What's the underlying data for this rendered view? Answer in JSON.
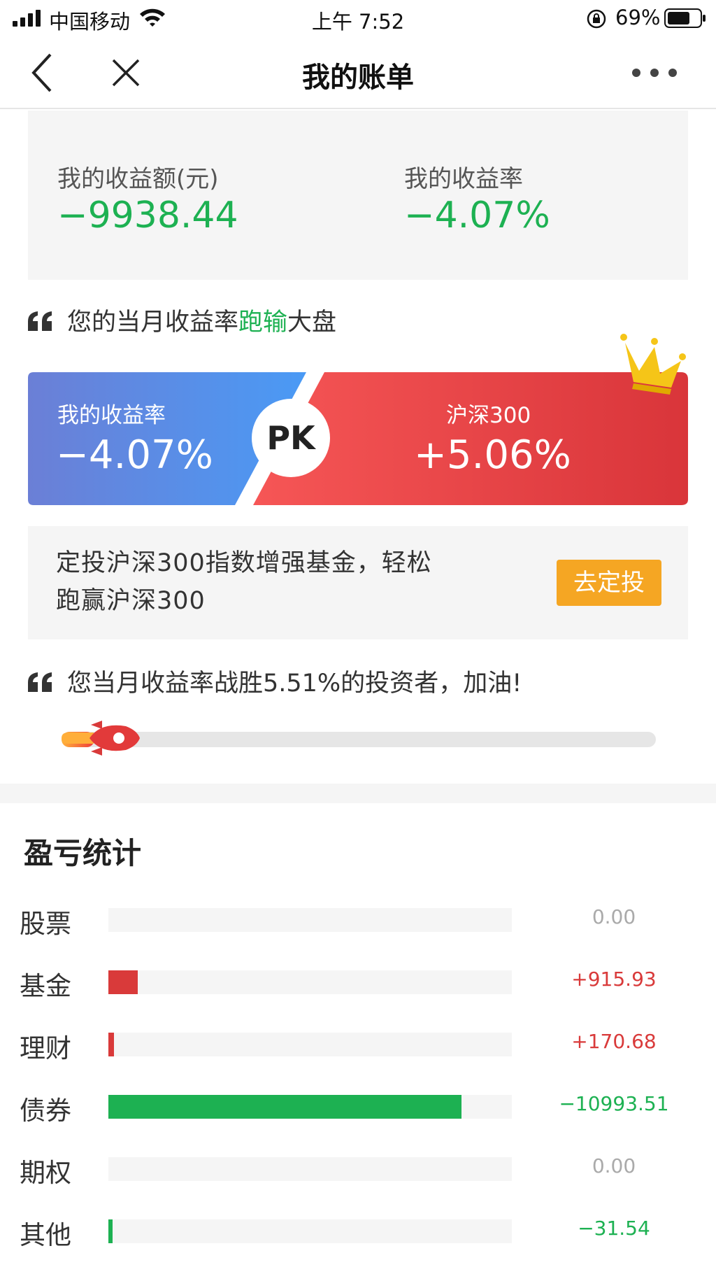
{
  "status_bar": {
    "carrier": "中国移动",
    "time": "上午 7:52",
    "battery": "69%"
  },
  "nav": {
    "title": "我的账单"
  },
  "summary": {
    "income_label": "我的收益额(元)",
    "income_value": "−9938.44",
    "rate_label": "我的收益率",
    "rate_value": "−4.07%"
  },
  "compare_quote": {
    "prefix": "您的当月收益率",
    "highlight": "跑输",
    "suffix": "大盘"
  },
  "pk": {
    "my_label": "我的收益率",
    "my_value": "−4.07%",
    "badge": "PK",
    "index_label": "沪深300",
    "index_value": "+5.06%"
  },
  "promo": {
    "line1": "定投沪深300指数增强基金，轻松",
    "line2": "跑赢沪深300",
    "button": "去定投"
  },
  "rank_quote": "您当月收益率战胜5.51%的投资者，加油!",
  "rank_progress": 0.0551,
  "stats": {
    "title": "盈亏统计",
    "colors": {
      "gain": "#d93a3a",
      "loss": "#1db152",
      "zero": "#aaaaaa"
    },
    "rows": [
      {
        "name": "股票",
        "amount": "0.00",
        "value": 0
      },
      {
        "name": "基金",
        "amount": "+915.93",
        "value": 915.93
      },
      {
        "name": "理财",
        "amount": "+170.68",
        "value": 170.68
      },
      {
        "name": "债券",
        "amount": "−10993.51",
        "value": -10993.51
      },
      {
        "name": "期权",
        "amount": "0.00",
        "value": 0
      },
      {
        "name": "其他",
        "amount": "−31.54",
        "value": -31.54
      }
    ]
  }
}
